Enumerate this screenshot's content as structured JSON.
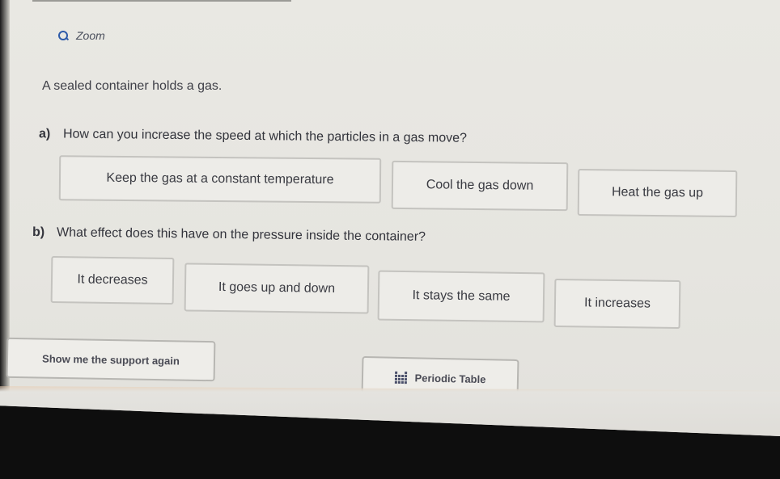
{
  "zoom": {
    "label": "Zoom",
    "icon": "magnifier-icon"
  },
  "intro": "A sealed container holds a gas.",
  "question_a": {
    "marker": "a)",
    "text": "How can you increase the speed at which the particles in a gas move?",
    "options": [
      "Keep the gas at a constant temperature",
      "Cool the gas down",
      "Heat the gas up"
    ]
  },
  "question_b": {
    "marker": "b)",
    "text": "What effect does this have on the pressure inside the container?",
    "options": [
      "It decreases",
      "It goes up and down",
      "It stays the same",
      "It increases"
    ]
  },
  "footer": {
    "support_label": "Show me the support again",
    "periodic_label": "Periodic Table",
    "periodic_icon": "periodic-table-icon"
  }
}
